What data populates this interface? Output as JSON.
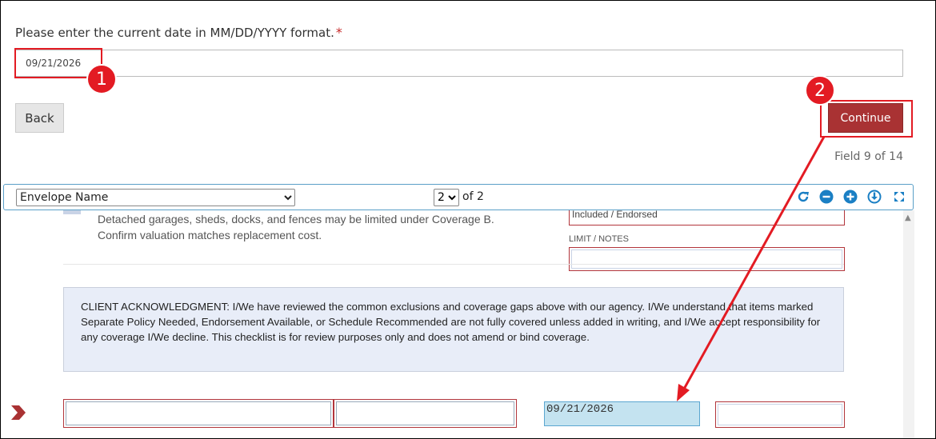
{
  "form": {
    "prompt": "Please enter the current date in MM/DD/YYYY format.",
    "required_mark": "*",
    "date_value": "09/21/2026",
    "back_label": "Back",
    "continue_label": "Continue",
    "field_counter": "Field 9 of 14"
  },
  "annotations": {
    "step1": "1",
    "step2": "2",
    "highlight_color": "#e31b23"
  },
  "viewer": {
    "envelope_select": "Envelope Name",
    "page_select": "2",
    "page_of": "of 2",
    "tools": [
      "refresh-icon",
      "zoom-out-icon",
      "zoom-in-icon",
      "download-icon",
      "fullscreen-icon"
    ]
  },
  "document": {
    "line1": "Detached garages, sheds, docks, and fences may be limited under Coverage B.",
    "line2": "Confirm valuation matches replacement cost.",
    "partial_field_value": "Included / Endorsed",
    "limit_notes_label": "LIMIT / NOTES",
    "acknowledgment": "CLIENT ACKNOWLEDGMENT: I/We have reviewed the common exclusions and coverage gaps above with our agency. I/We understand that items marked Separate Policy Needed, Endorsement Available, or Schedule Recommended are not fully covered unless added in writing, and I/We accept responsibility for any coverage I/We decline. This checklist is for review purposes only and does not amend or bind coverage.",
    "date_field_value": "09/21/2026"
  },
  "colors": {
    "continue_bg": "#a93233",
    "field_border": "#b2353b",
    "active_field_bg": "#c4e3f0",
    "ack_bg": "#e8edf8"
  }
}
